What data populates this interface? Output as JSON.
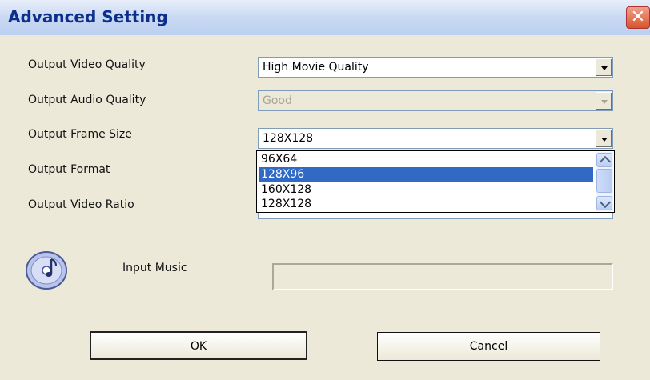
{
  "window": {
    "title": "Advanced Setting",
    "close_glyph": "✕"
  },
  "fields": {
    "video_quality": {
      "label": "Output Video Quality",
      "value": "High Movie Quality"
    },
    "audio_quality": {
      "label": "Output Audio Quality",
      "value": "Good",
      "disabled": true
    },
    "frame_size": {
      "label": "Output Frame Size",
      "value": "128X128"
    },
    "format": {
      "label": "Output Format"
    },
    "video_ratio": {
      "label": "Output Video Ratio"
    },
    "input_music": {
      "label": "Input Music",
      "value": ""
    }
  },
  "frame_size_dropdown": {
    "options": [
      "96X64",
      "128X96",
      "160X128",
      "128X128"
    ],
    "highlighted": "128X96"
  },
  "buttons": {
    "ok": "OK",
    "cancel": "Cancel"
  },
  "colors": {
    "highlight": "#316ac5",
    "title_text": "#0b2f8a",
    "background": "#ece9d8"
  }
}
